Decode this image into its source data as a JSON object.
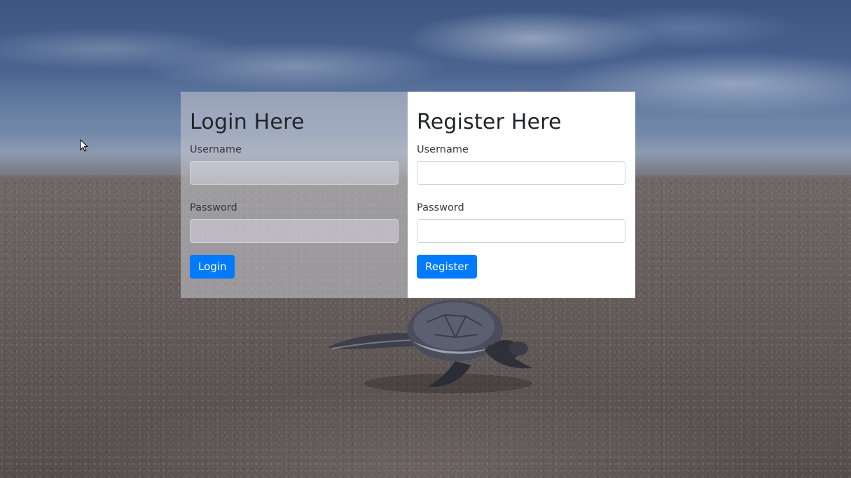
{
  "login": {
    "title": "Login Here",
    "username_label": "Username",
    "username_value": "",
    "password_label": "Password",
    "password_value": "",
    "button_label": "Login"
  },
  "register": {
    "title": "Register Here",
    "username_label": "Username",
    "username_value": "",
    "password_label": "Password",
    "password_value": "",
    "button_label": "Register"
  },
  "colors": {
    "button": "#007bff",
    "heading": "#212529"
  },
  "icons": {
    "cursor": "mouse-pointer-icon"
  }
}
